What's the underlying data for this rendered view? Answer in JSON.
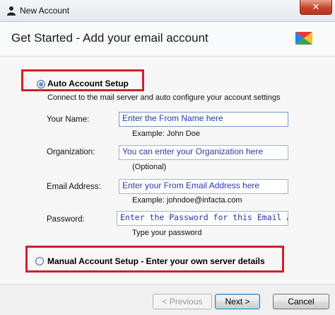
{
  "window": {
    "title": "New Account",
    "close_glyph": "✕"
  },
  "header": {
    "title": "Get Started - Add your email account",
    "logo_icon": "app-logo-icon"
  },
  "auto_setup": {
    "label": "Auto Account Setup",
    "selected": true,
    "description": "Connect to the mail server and auto configure your account settings"
  },
  "fields": [
    {
      "label": "Your Name:",
      "value": "Enter the From Name here",
      "hint": "Example: John Doe"
    },
    {
      "label": "Organization:",
      "value": "You can enter your Organization here",
      "hint": "(Optional)"
    },
    {
      "label": "Email Address:",
      "value": "Enter your From Email Address here",
      "hint": "Example: johndoe@infacta.com"
    },
    {
      "label": "Password:",
      "value": "Enter the Password for this Email Addr",
      "hint": "Type your password"
    }
  ],
  "manual_setup": {
    "label": "Manual Account Setup - Enter your own server details",
    "selected": false
  },
  "footer": {
    "previous_label": "< Previous",
    "next_label": "Next >",
    "cancel_label": "Cancel"
  },
  "colors": {
    "highlight": "#d21f29",
    "input_text": "#2b37a8",
    "close": "#c7432c"
  }
}
